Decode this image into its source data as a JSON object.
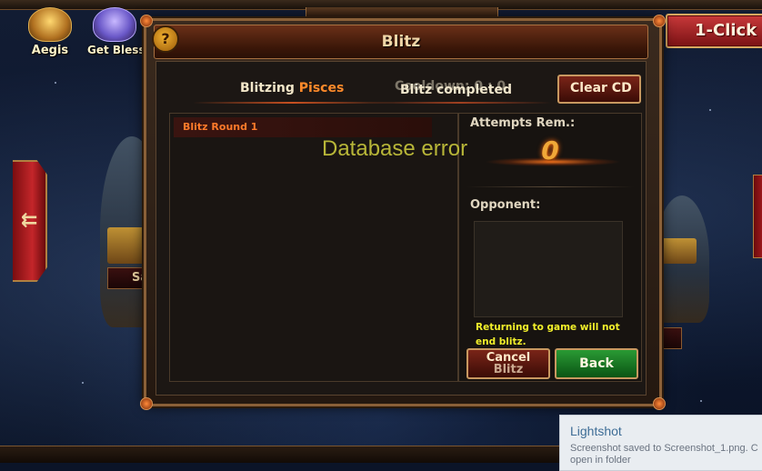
{
  "hud": {
    "aegis_label": "Aegis",
    "bless_label": "Get Blessi",
    "one_click_label": "1-Click",
    "left_small_tab": "Sa"
  },
  "modal": {
    "title": "Blitz",
    "help_label": "?",
    "blitzing_prefix": "Blitzing",
    "blitzing_target": "Pisces",
    "cooldown_text": "Cooldown: 0 : 0",
    "blitz_status": "Blitz completed",
    "clear_cd_label": "Clear CD",
    "rounds": [
      {
        "label": "Blitz Round 1"
      }
    ],
    "attempts_label": "Attempts Rem.:",
    "attempts_value": "0",
    "opponent_label": "Opponent:",
    "notice": "Returning to game will not end blitz.",
    "cancel_label_line1": "Cancel",
    "cancel_label_line2": "Blitz",
    "back_label": "Back",
    "error_text": "Database error"
  },
  "toast": {
    "title": "Lightshot",
    "message_line1": "Screenshot saved to Screenshot_1.png. C",
    "message_line2": "open in folder"
  },
  "colors": {
    "accent_orange": "#ff8a2a",
    "notice_yellow": "#f2f02a",
    "error_olive": "#b8b638",
    "back_green": "#2a9a34"
  },
  "icons": [
    "help-icon",
    "aegis-emblem-icon",
    "blessing-emblem-icon",
    "left-arrow-icon"
  ]
}
